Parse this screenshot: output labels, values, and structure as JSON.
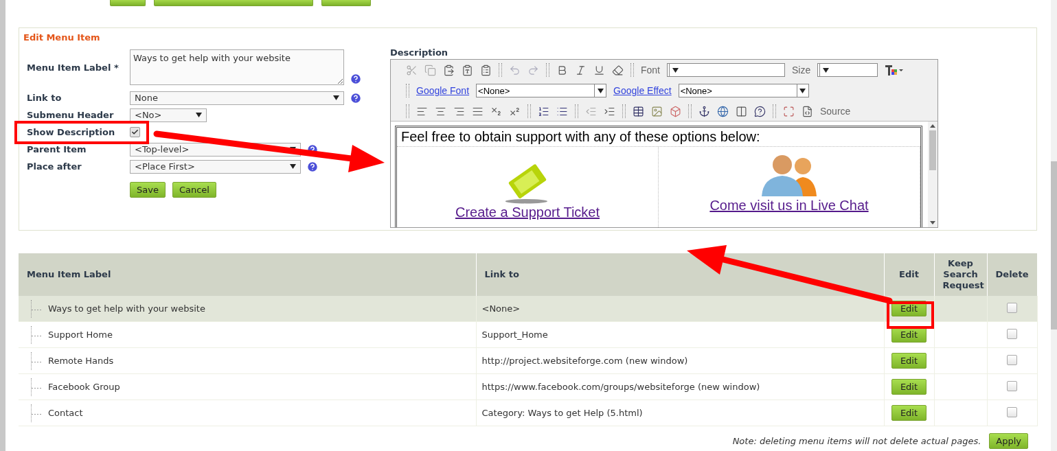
{
  "form": {
    "title": "Edit Menu Item",
    "fields": [
      {
        "kind": "textarea",
        "label": "Menu Item Label *",
        "value": "Ways to get help with your website",
        "help": true
      },
      {
        "kind": "wide-select",
        "label": "Link to",
        "value": "None",
        "help": true
      },
      {
        "kind": "short-select",
        "label": "Submenu Header",
        "value": "<No>",
        "help": false
      },
      {
        "kind": "checkbox",
        "label": "Show Description",
        "checked": true,
        "help": false
      },
      {
        "kind": "select",
        "label": "Parent Item",
        "value": "<Top-level>",
        "help": true
      },
      {
        "kind": "select",
        "label": "Place after",
        "value": "<Place First>",
        "help": true
      }
    ],
    "buttons": [
      "Save",
      "Cancel"
    ]
  },
  "editor": {
    "label": "Description",
    "font_label": "Font",
    "size_label": "Size",
    "google_font_label": "Google Font",
    "google_font_value": "<None>",
    "google_effect_label": "Google Effect",
    "google_effect_value": "<None>",
    "source_label": "Source",
    "content": {
      "heading": "Feel free to obtain support with any of these options below:",
      "ticket_link": "Create a Support Ticket",
      "chat_link": "Come visit us in Live Chat"
    }
  },
  "table": {
    "columns": [
      "Menu Item Label",
      "Link to",
      "Edit",
      "Keep Search Request",
      "Delete"
    ],
    "rows": [
      {
        "label": "Ways to get help with your website",
        "link": "<None>",
        "edit": "Edit",
        "delete": false,
        "selected": true
      },
      {
        "label": "Support Home",
        "link": "Support_Home",
        "edit": "Edit",
        "delete": false,
        "selected": false
      },
      {
        "label": "Remote Hands",
        "link": "http://project.websiteforge.com (new window)",
        "edit": "Edit",
        "delete": false,
        "selected": false
      },
      {
        "label": "Facebook Group",
        "link": "https://www.facebook.com/groups/websiteforge (new window)",
        "edit": "Edit",
        "delete": false,
        "selected": false
      },
      {
        "label": "Contact",
        "link": "Category: Ways to get Help (5.html)",
        "edit": "Edit",
        "delete": false,
        "selected": false
      }
    ],
    "note": "Note: deleting menu items will not delete actual pages.",
    "apply": "Apply"
  }
}
